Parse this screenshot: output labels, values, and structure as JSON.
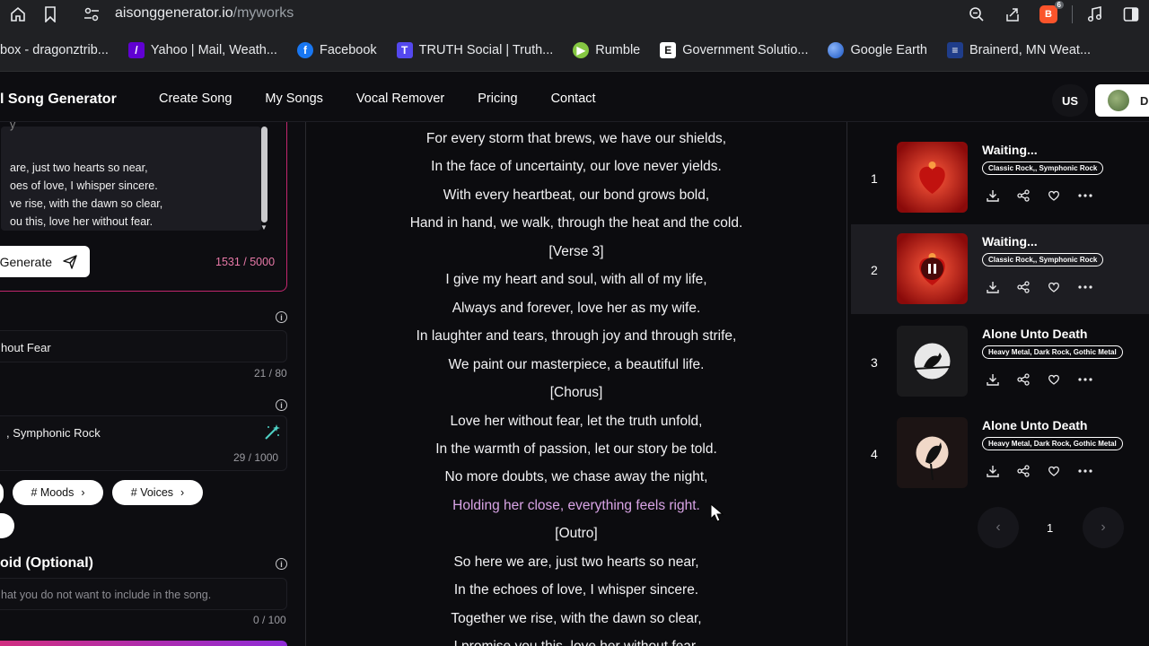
{
  "browser": {
    "url_host": "aisonggenerator.io",
    "url_path": "/myworks",
    "brave_badge": "6"
  },
  "bookmarks": [
    {
      "label": "box - dragonztrib...",
      "icon": "mail-icon",
      "color": "#202124"
    },
    {
      "label": "Yahoo | Mail, Weath...",
      "icon": "yahoo-icon",
      "color": "#6001d2"
    },
    {
      "label": "Facebook",
      "icon": "facebook-icon",
      "color": "#1877f2"
    },
    {
      "label": "TRUTH Social | Truth...",
      "icon": "truth-social-icon",
      "color": "#5448ee"
    },
    {
      "label": "Rumble",
      "icon": "rumble-icon",
      "color": "#85c742"
    },
    {
      "label": "Government Solutio...",
      "icon": "government-solutions-icon",
      "color": "#ffffff"
    },
    {
      "label": "Google Earth",
      "icon": "google-earth-icon",
      "color": "#4285f4"
    },
    {
      "label": "Brainerd, MN Weat...",
      "icon": "weather-channel-icon",
      "color": "#1f3d8a"
    }
  ],
  "app": {
    "brand": "l Song Generator",
    "nav": [
      "Create Song",
      "My Songs",
      "Vocal Remover",
      "Pricing",
      "Contact"
    ],
    "lang": "US",
    "account_letter": "D"
  },
  "left": {
    "lyrics_lines": [
      "are, just two hearts so near,",
      "oes of love, I whisper sincere.",
      "ve rise, with the dawn so clear,",
      "ou this, love her without fear."
    ],
    "generate_label": "Generate",
    "lyrics_count": "1531 / 5000",
    "title_value": "hout Fear",
    "title_count": "21 / 80",
    "style_value": ", Symphonic Rock",
    "style_count": "29 / 1000",
    "chip_moods": "# Moods",
    "chip_voices": "# Voices",
    "avoid_title": "oid (Optional)",
    "avoid_placeholder": "hat you do not want to include in the song.",
    "avoid_count": "0 / 100"
  },
  "lyrics": [
    {
      "text": "For every storm that brews, we have our shields,",
      "hl": false
    },
    {
      "text": "In the face of uncertainty, our love never yields.",
      "hl": false
    },
    {
      "text": "With every heartbeat, our bond grows bold,",
      "hl": false
    },
    {
      "text": "Hand in hand, we walk, through the heat and the cold.",
      "hl": false
    },
    {
      "text": "[Verse 3]",
      "hl": false
    },
    {
      "text": "I give my heart and soul, with all of my life,",
      "hl": false
    },
    {
      "text": "Always and forever, love her as my wife.",
      "hl": false
    },
    {
      "text": "In laughter and tears, through joy and through strife,",
      "hl": false
    },
    {
      "text": "We paint our masterpiece, a beautiful life.",
      "hl": false
    },
    {
      "text": "[Chorus]",
      "hl": false
    },
    {
      "text": "Love her without fear, let the truth unfold,",
      "hl": false
    },
    {
      "text": "In the warmth of passion, let our story be told.",
      "hl": false
    },
    {
      "text": "No more doubts, we chase away the night,",
      "hl": false
    },
    {
      "text": "Holding her close, everything feels right.",
      "hl": true
    },
    {
      "text": "[Outro]",
      "hl": false
    },
    {
      "text": "So here we are, just two hearts so near,",
      "hl": false
    },
    {
      "text": "In the echoes of love, I whisper sincere.",
      "hl": false
    },
    {
      "text": "Together we rise, with the dawn so clear,",
      "hl": false
    },
    {
      "text": "I promise you this, love her without fear.",
      "hl": false
    }
  ],
  "songs": [
    {
      "num": "1",
      "title": "Waiting...",
      "tags": "Classic Rock,, Symphonic Rock",
      "art": "red-heart",
      "active": false,
      "playing": false
    },
    {
      "num": "2",
      "title": "Waiting...",
      "tags": "Classic Rock,, Symphonic Rock",
      "art": "red-heart",
      "active": true,
      "playing": true
    },
    {
      "num": "3",
      "title": "Alone Unto Death",
      "tags": "Heavy Metal, Dark Rock, Gothic Metal",
      "art": "moon-raven",
      "active": false,
      "playing": false
    },
    {
      "num": "4",
      "title": "Alone Unto Death",
      "tags": "Heavy Metal, Dark Rock, Gothic Metal",
      "art": "moon-raven-red",
      "active": false,
      "playing": false
    }
  ],
  "pagination": {
    "current": "1"
  }
}
